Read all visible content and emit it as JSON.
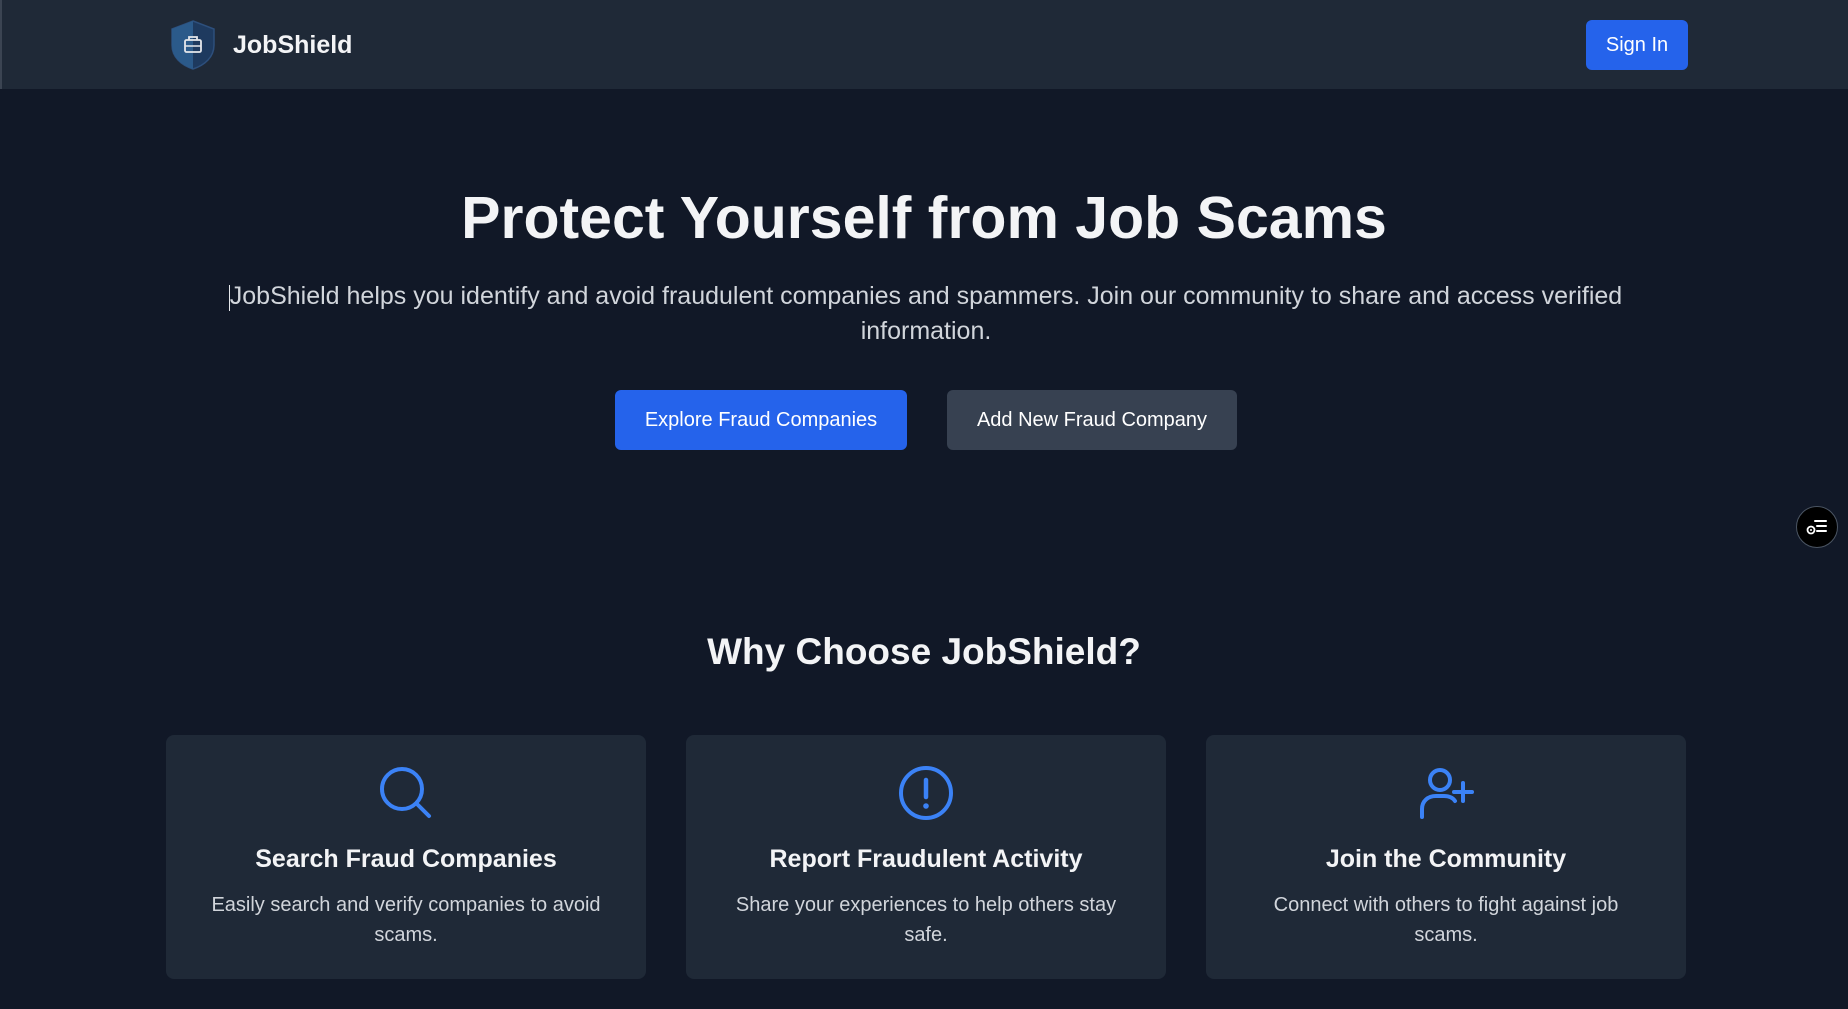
{
  "header": {
    "brand_name": "JobShield",
    "sign_in_label": "Sign In"
  },
  "hero": {
    "title": "Protect Yourself from Job Scams",
    "subtitle": "JobShield helps you identify and avoid fraudulent companies and spammers. Join our community to share and access verified information.",
    "explore_label": "Explore Fraud Companies",
    "add_label": "Add New Fraud Company"
  },
  "features": {
    "title": "Why Choose JobShield?",
    "cards": [
      {
        "icon": "search-icon",
        "title": "Search Fraud Companies",
        "description": "Easily search and verify companies to avoid scams."
      },
      {
        "icon": "alert-circle-icon",
        "title": "Report Fraudulent Activity",
        "description": "Share your experiences to help others stay safe."
      },
      {
        "icon": "user-plus-icon",
        "title": "Join the Community",
        "description": "Connect with others to fight against job scams."
      }
    ]
  },
  "colors": {
    "background": "#111827",
    "surface": "#1f2937",
    "accent": "#2563eb",
    "icon_accent": "#3b82f6",
    "secondary_button": "#374151"
  }
}
